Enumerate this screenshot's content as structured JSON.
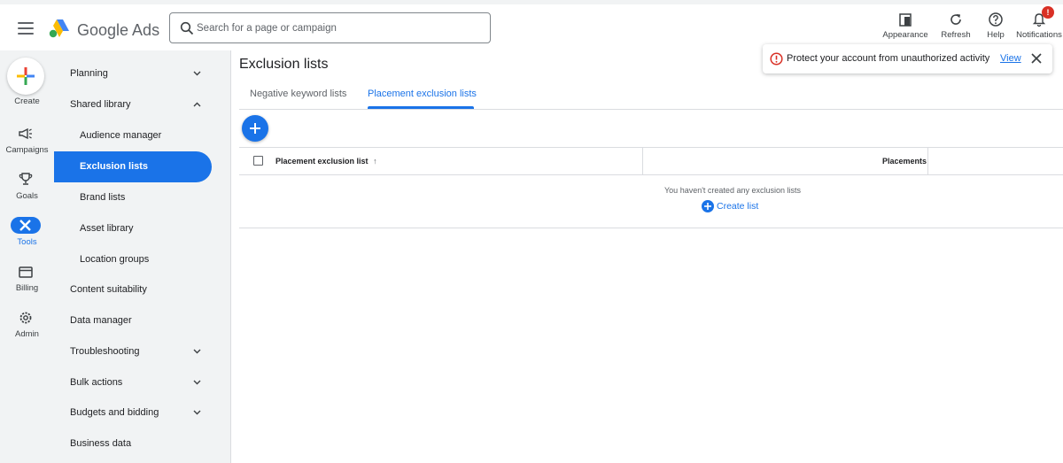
{
  "header": {
    "product_name": "Google Ads",
    "search_placeholder": "Search for a page or campaign",
    "actions": [
      {
        "label": "Appearance",
        "icon": "appearance-icon"
      },
      {
        "label": "Refresh",
        "icon": "refresh-icon"
      },
      {
        "label": "Help",
        "icon": "help-icon"
      },
      {
        "label": "Notifications",
        "icon": "bell-icon"
      }
    ],
    "notification_badge": "!"
  },
  "rail": {
    "items": [
      {
        "label": "Create",
        "icon": "plus-icon"
      },
      {
        "label": "Campaigns",
        "icon": "megaphone-icon"
      },
      {
        "label": "Goals",
        "icon": "trophy-icon"
      },
      {
        "label": "Tools",
        "icon": "wrench-icon"
      },
      {
        "label": "Billing",
        "icon": "card-icon"
      },
      {
        "label": "Admin",
        "icon": "gear-icon"
      }
    ]
  },
  "sidenav": {
    "items": [
      {
        "label": "Planning"
      },
      {
        "label": "Shared library"
      },
      {
        "label": "Audience manager"
      },
      {
        "label": "Exclusion lists"
      },
      {
        "label": "Brand lists"
      },
      {
        "label": "Asset library"
      },
      {
        "label": "Location groups"
      },
      {
        "label": "Content suitability"
      },
      {
        "label": "Data manager"
      },
      {
        "label": "Troubleshooting"
      },
      {
        "label": "Bulk actions"
      },
      {
        "label": "Budgets and bidding"
      },
      {
        "label": "Business data"
      }
    ]
  },
  "main": {
    "title": "Exclusion lists",
    "tabs": [
      {
        "label": "Negative keyword lists"
      },
      {
        "label": "Placement exclusion lists"
      }
    ],
    "table": {
      "columns": [
        "Placement exclusion list",
        "Placements"
      ],
      "sort_indicator": "↑",
      "empty_message": "You haven't created any exclusion lists",
      "create_label": "Create list"
    }
  },
  "alert": {
    "message": "Protect your account from unauthorized activity",
    "link": "View"
  },
  "colors": {
    "accent": "#1a73e8",
    "error": "#d93025",
    "rail_bg": "#f1f3f4"
  }
}
